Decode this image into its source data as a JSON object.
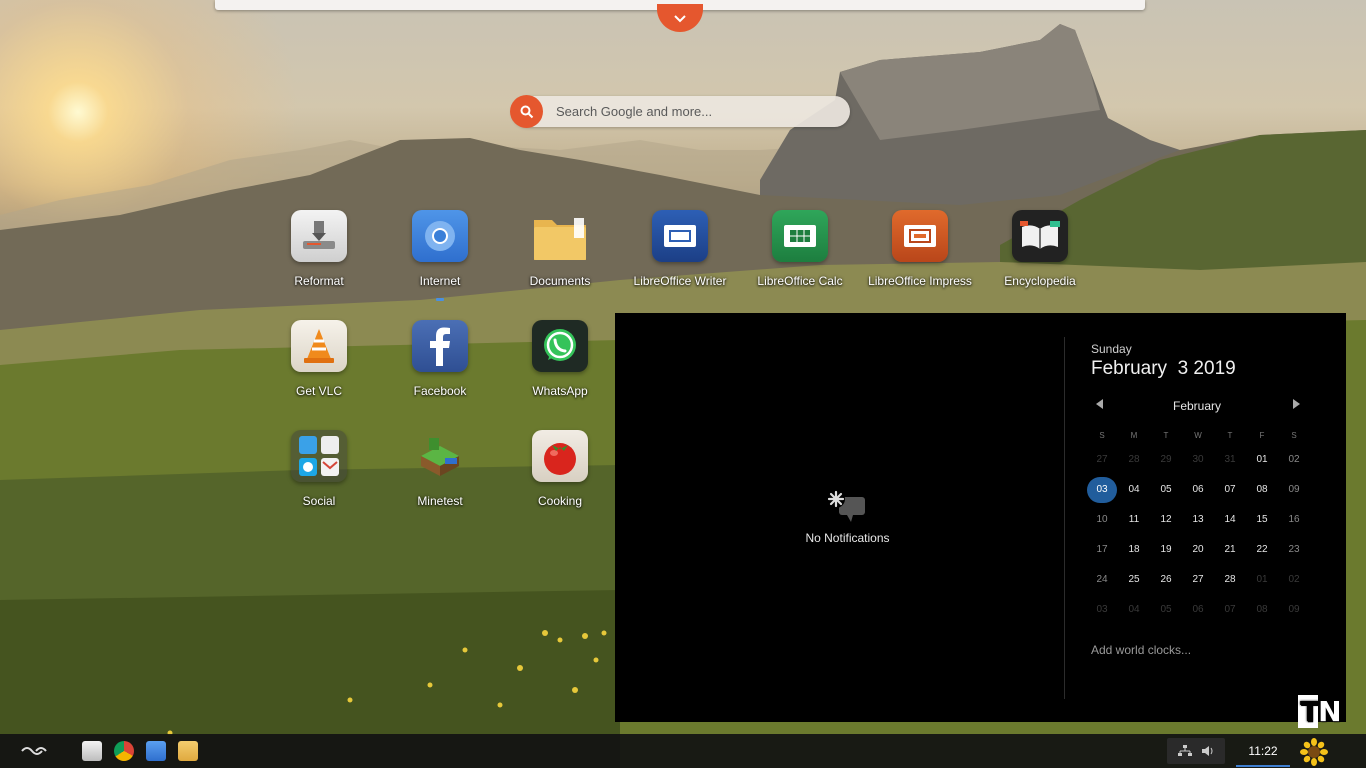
{
  "search": {
    "placeholder": "Search Google and more..."
  },
  "apps": [
    {
      "label": "Reformat",
      "icon": "usb-drive-icon"
    },
    {
      "label": "Internet",
      "icon": "chromium-icon"
    },
    {
      "label": "Documents",
      "icon": "folder-icon"
    },
    {
      "label": "LibreOffice Writer",
      "icon": "writer-icon"
    },
    {
      "label": "LibreOffice Calc",
      "icon": "calc-icon"
    },
    {
      "label": "LibreOffice Impress",
      "icon": "impress-icon"
    },
    {
      "label": "Encyclopedia",
      "icon": "book-icon"
    },
    {
      "label": "Get VLC",
      "icon": "vlc-cone-icon"
    },
    {
      "label": "Facebook",
      "icon": "facebook-icon"
    },
    {
      "label": "WhatsApp",
      "icon": "whatsapp-icon"
    },
    {
      "label": "Social",
      "icon": "social-folder-icon"
    },
    {
      "label": "Minetest",
      "icon": "minetest-icon"
    },
    {
      "label": "Cooking",
      "icon": "tomato-icon"
    }
  ],
  "notifications": {
    "empty_text": "No Notifications"
  },
  "calendar": {
    "weekday": "Sunday",
    "date_long": "February  3 2019",
    "month": "February",
    "weekday_headers": [
      "S",
      "M",
      "T",
      "W",
      "T",
      "F",
      "S"
    ],
    "weeks": [
      [
        "27",
        "28",
        "29",
        "30",
        "31",
        "01",
        "02"
      ],
      [
        "03",
        "04",
        "05",
        "06",
        "07",
        "08",
        "09"
      ],
      [
        "10",
        "11",
        "12",
        "13",
        "14",
        "15",
        "16"
      ],
      [
        "17",
        "18",
        "19",
        "20",
        "21",
        "22",
        "23"
      ],
      [
        "24",
        "25",
        "26",
        "27",
        "28",
        "01",
        "02"
      ],
      [
        "03",
        "04",
        "05",
        "06",
        "07",
        "08",
        "09"
      ]
    ],
    "today": "03",
    "add_world_clocks": "Add world clocks..."
  },
  "taskbar": {
    "pinned": [
      "files-icon",
      "chrome-icon",
      "chromium-icon",
      "folder-icon"
    ],
    "clock": "11:22"
  },
  "watermark": "TN",
  "colors": {
    "accent": "#e5572e",
    "today_highlight": "#215d9c",
    "panel_bg": "#000000"
  }
}
